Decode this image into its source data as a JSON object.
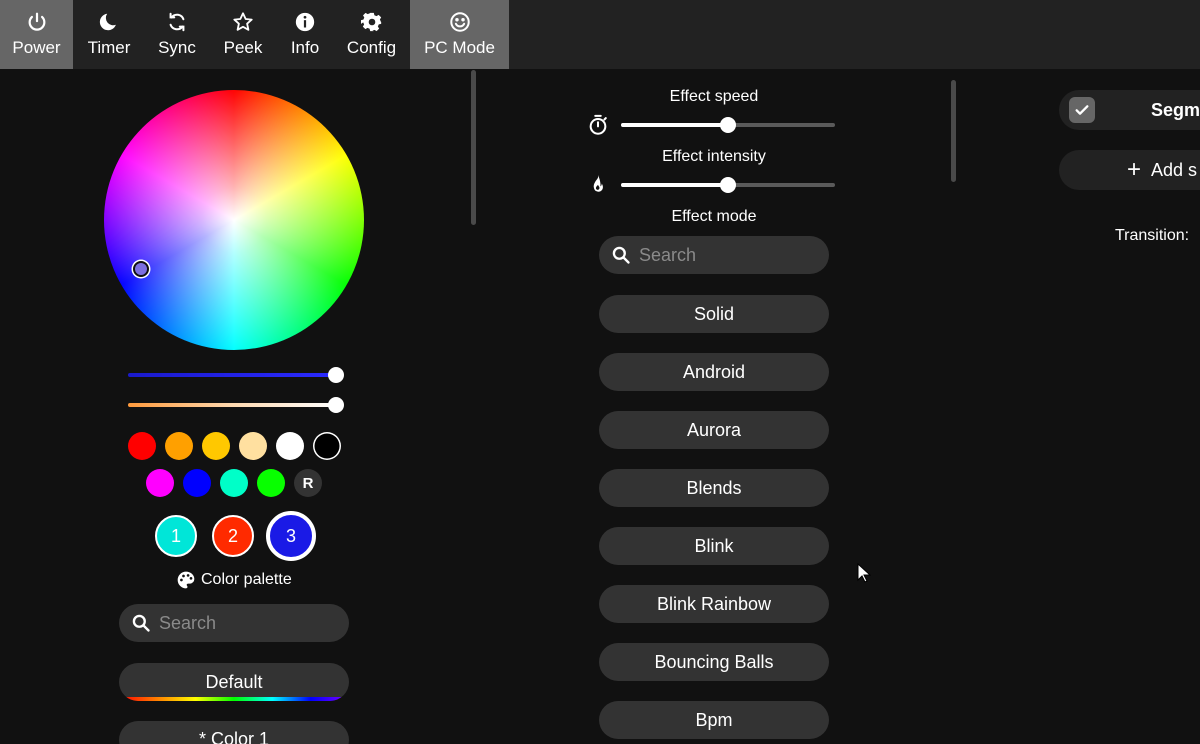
{
  "nav": {
    "items": [
      {
        "label": "Power",
        "icon": "power-icon"
      },
      {
        "label": "Timer",
        "icon": "moon-icon"
      },
      {
        "label": "Sync",
        "icon": "sync-icon"
      },
      {
        "label": "Peek",
        "icon": "star-icon"
      },
      {
        "label": "Info",
        "icon": "info-icon"
      },
      {
        "label": "Config",
        "icon": "gear-icon"
      },
      {
        "label": "PC Mode",
        "icon": "smiley-icon"
      }
    ],
    "active": [
      "Power",
      "PC Mode"
    ]
  },
  "colors": {
    "quick": [
      "#ff0000",
      "#ffa000",
      "#ffc800",
      "#ffe0a0",
      "#ffffff",
      "#000000",
      "#ff00ff",
      "#0000ff",
      "#00ffc8",
      "#08ff00"
    ],
    "random_label": "R",
    "slots": [
      {
        "label": "1",
        "color": "#00e6d8"
      },
      {
        "label": "2",
        "color": "#ff2a00"
      },
      {
        "label": "3",
        "color": "#1a1ae6"
      }
    ],
    "selected_slot": "3",
    "brightness": 1.0,
    "white_balance": 1.0
  },
  "palette": {
    "title": "Color palette",
    "search_placeholder": "Search",
    "items": [
      "Default",
      "* Color 1"
    ]
  },
  "effects": {
    "speed_label": "Effect speed",
    "speed_value": 0.5,
    "intensity_label": "Effect intensity",
    "intensity_value": 0.5,
    "mode_label": "Effect mode",
    "search_placeholder": "Search",
    "list": [
      "Solid",
      "Android",
      "Aurora",
      "Blends",
      "Blink",
      "Blink Rainbow",
      "Bouncing Balls",
      "Bpm"
    ]
  },
  "segments": {
    "segment_label": "Segm",
    "add_label": "Add s",
    "transition_label": "Transition: "
  }
}
